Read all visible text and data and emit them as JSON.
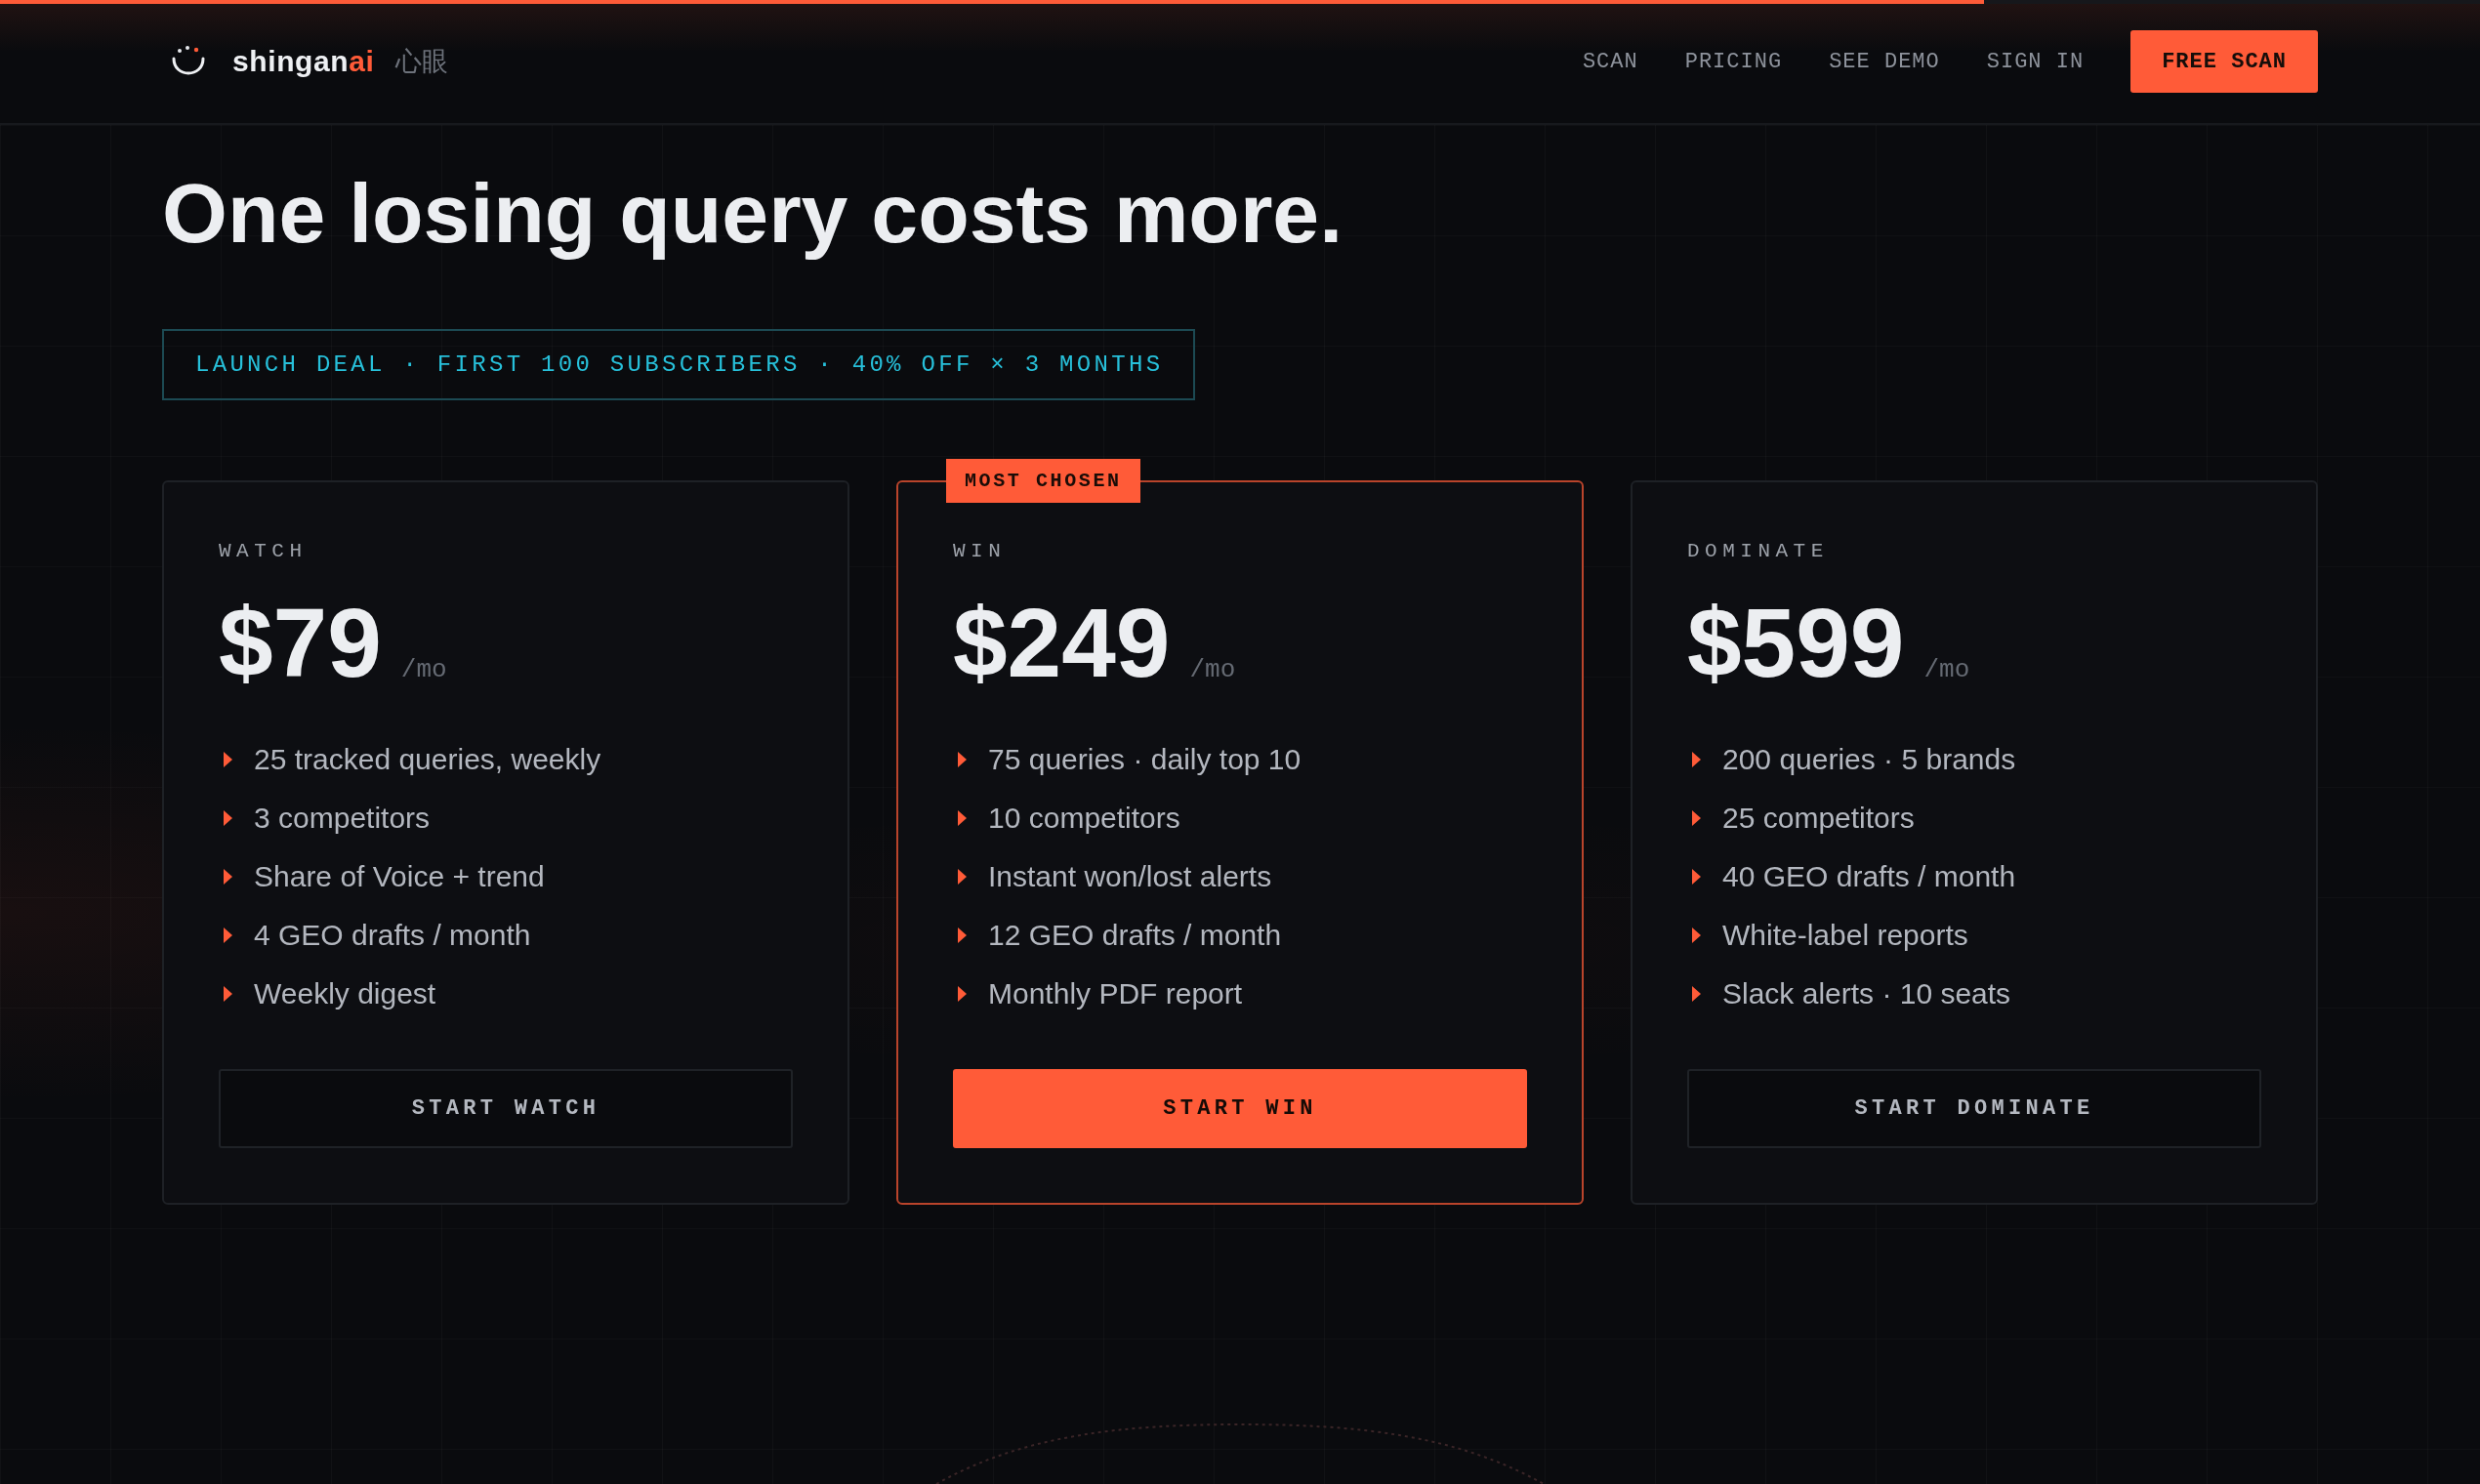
{
  "progress": {
    "level": 0.8
  },
  "header": {
    "brand": {
      "name": "shingan",
      "accent": "ai",
      "kanji": "心眼"
    },
    "nav": [
      "SCAN",
      "PRICING",
      "SEE DEMO",
      "SIGN IN"
    ],
    "cta": "FREE SCAN"
  },
  "hero": {
    "headline": "One losing query costs more.",
    "banner": "LAUNCH DEAL · FIRST 100 SUBSCRIBERS · 40% OFF × 3 MONTHS"
  },
  "plans": [
    {
      "name": "WATCH",
      "price": "$79",
      "period": "/mo",
      "featured": false,
      "features": [
        "25 tracked queries, weekly",
        "3 competitors",
        "Share of Voice + trend",
        "4 GEO drafts / month",
        "Weekly digest"
      ],
      "button": "START WATCH"
    },
    {
      "name": "WIN",
      "badge": "MOST CHOSEN",
      "price": "$249",
      "period": "/mo",
      "featured": true,
      "features": [
        "75 queries · daily top 10",
        "10 competitors",
        "Instant won/lost alerts",
        "12 GEO drafts / month",
        "Monthly PDF report"
      ],
      "button": "START WIN"
    },
    {
      "name": "DOMINATE",
      "price": "$599",
      "period": "/mo",
      "featured": false,
      "features": [
        "200 queries · 5 brands",
        "25 competitors",
        "40 GEO drafts / month",
        "White-label reports",
        "Slack alerts · 10 seats"
      ],
      "button": "START DOMINATE"
    }
  ]
}
